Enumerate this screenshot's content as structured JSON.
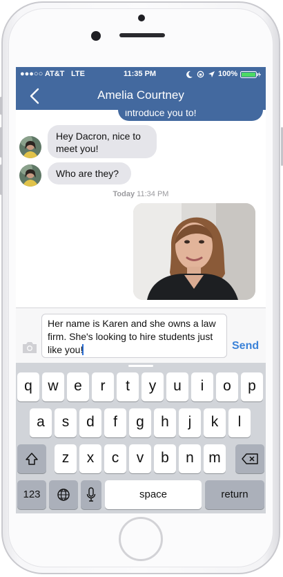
{
  "status_bar": {
    "carrier": "●●●○○ AT&T",
    "network": "LTE",
    "time": "11:35 PM",
    "battery": "100%"
  },
  "header": {
    "title": "Amelia Courtney"
  },
  "messages": {
    "outgoing_partial": "introduce you to!",
    "incoming": [
      "Hey Dacron, nice to meet you!",
      "Who are they?"
    ],
    "timestamp_day": "Today",
    "timestamp_time": "11:34 PM"
  },
  "composer": {
    "value": "Her name is Karen and she owns a law firm. She's looking to hire students just like you!",
    "send_label": "Send"
  },
  "keyboard": {
    "row1": [
      "q",
      "w",
      "e",
      "r",
      "t",
      "y",
      "u",
      "i",
      "o",
      "p"
    ],
    "row2": [
      "a",
      "s",
      "d",
      "f",
      "g",
      "h",
      "j",
      "k",
      "l"
    ],
    "row3": [
      "z",
      "x",
      "c",
      "v",
      "b",
      "n",
      "m"
    ],
    "numbers_label": "123",
    "space_label": "space",
    "return_label": "return"
  },
  "colors": {
    "accent": "#43699f",
    "send": "#3b82d8",
    "incoming_bubble": "#e5e5ea",
    "keyboard_bg": "#d1d4d9"
  }
}
